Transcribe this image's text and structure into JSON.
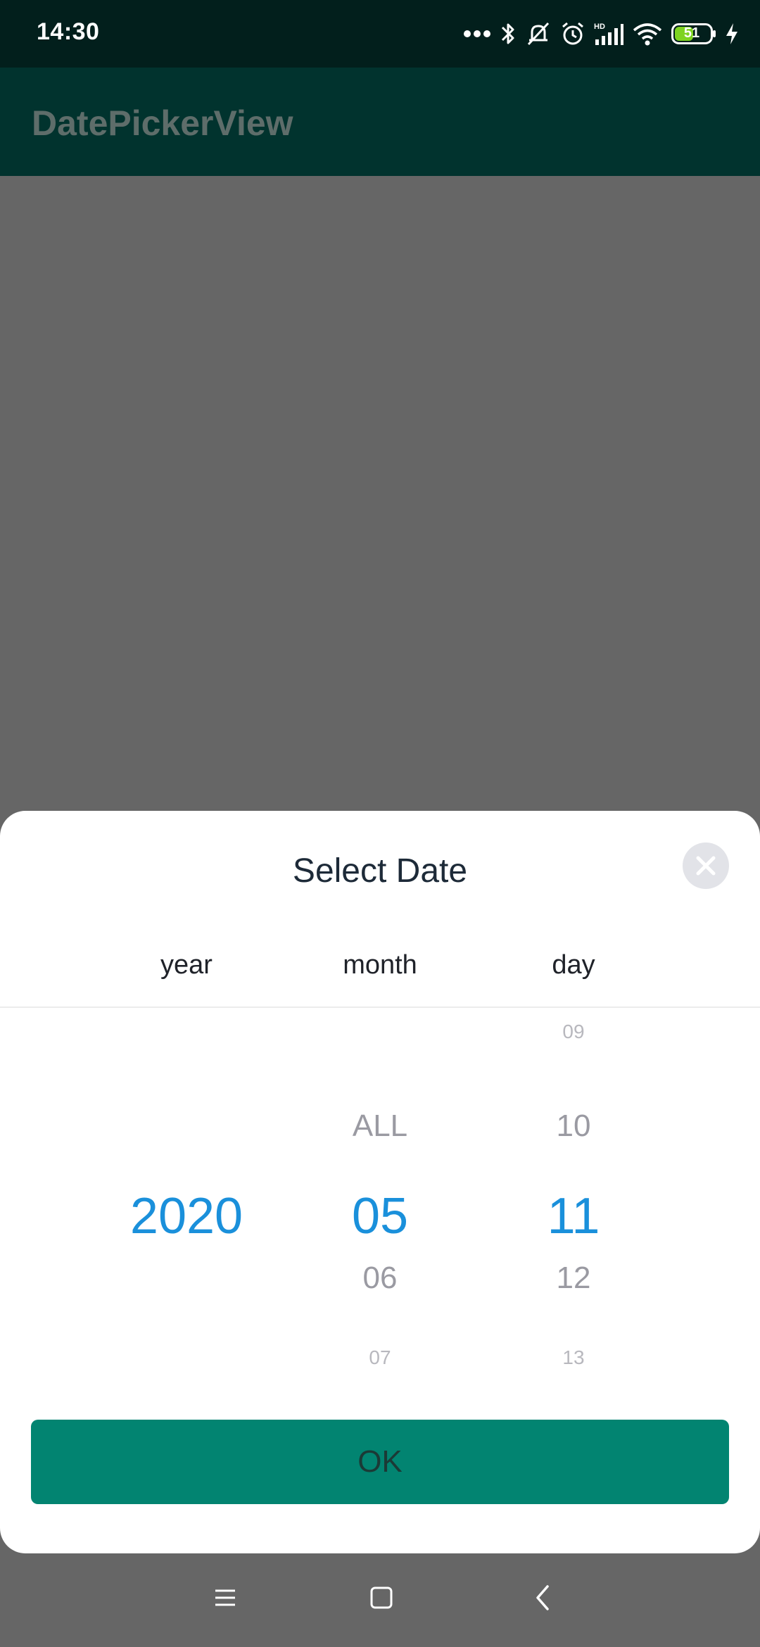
{
  "status_bar": {
    "time": "14:30",
    "battery": "51",
    "icons": [
      "more-dots-icon",
      "bluetooth-icon",
      "mute-icon",
      "alarm-icon",
      "hd-signal-icon",
      "wifi-icon",
      "battery-icon",
      "charging-icon"
    ]
  },
  "app_bar": {
    "title": "DatePickerView"
  },
  "dialog": {
    "title": "Select Date",
    "close_icon": "close-icon",
    "columns": {
      "year": {
        "label": "year",
        "selected": "2020"
      },
      "month": {
        "label": "month",
        "above": "ALL",
        "selected": "05",
        "below": [
          "06",
          "07"
        ]
      },
      "day": {
        "label": "day",
        "above": [
          "09",
          "10"
        ],
        "selected": "11",
        "below": [
          "12",
          "13"
        ]
      }
    },
    "ok_label": "OK",
    "colors": {
      "selected": "#1a90db",
      "ok_button": "#028471"
    }
  },
  "nav_bar": {
    "icons": [
      "menu-icon",
      "home-icon",
      "back-icon"
    ]
  }
}
